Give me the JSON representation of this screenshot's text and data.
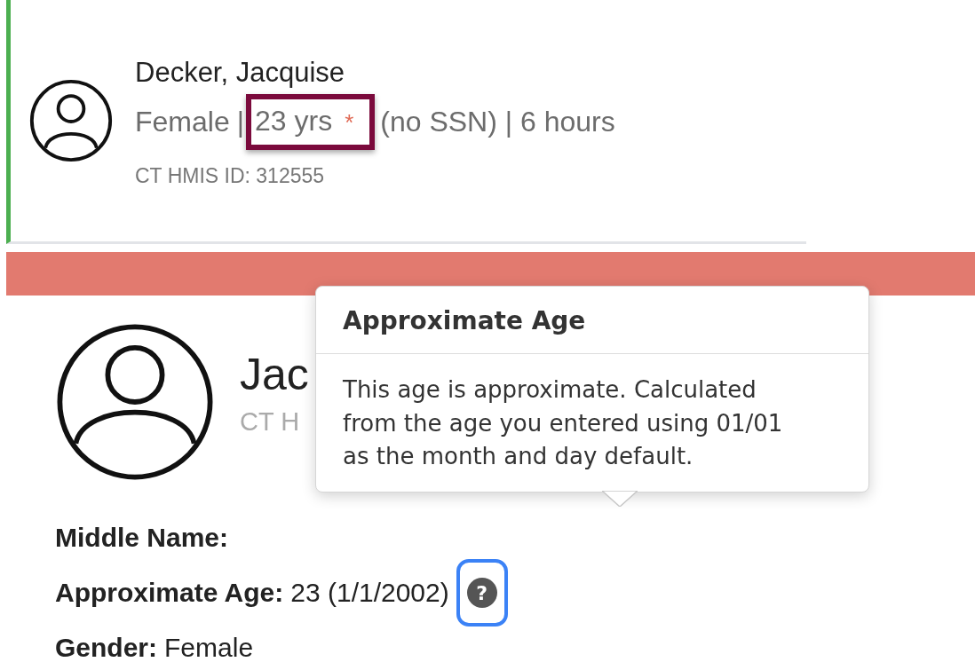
{
  "client_card": {
    "name": "Decker, Jacquise",
    "gender": "Female",
    "separator": "|",
    "age": "23 yrs",
    "age_flag": "*",
    "age_highlighted": true,
    "rest": "(no SSN) | 6 hours",
    "id_line": "CT HMIS ID: 312555"
  },
  "alert_bar": {
    "color": "#e27a6f"
  },
  "profile": {
    "name": "Jac",
    "id_line": "CT H",
    "fields": [
      {
        "label": "Middle Name:",
        "kind": "text"
      },
      {
        "label": "Approximate Age:",
        "value": "23 (1/1/2002)",
        "kind": "help",
        "help_text": "?",
        "focused": true
      },
      {
        "label": "Gender:",
        "value": "Female",
        "kind": "text"
      }
    ]
  },
  "tooltip": {
    "title": "Approximate Age",
    "body": "This age is approximate. Calculated from the age you entered using 01/01 as the month and day default."
  }
}
